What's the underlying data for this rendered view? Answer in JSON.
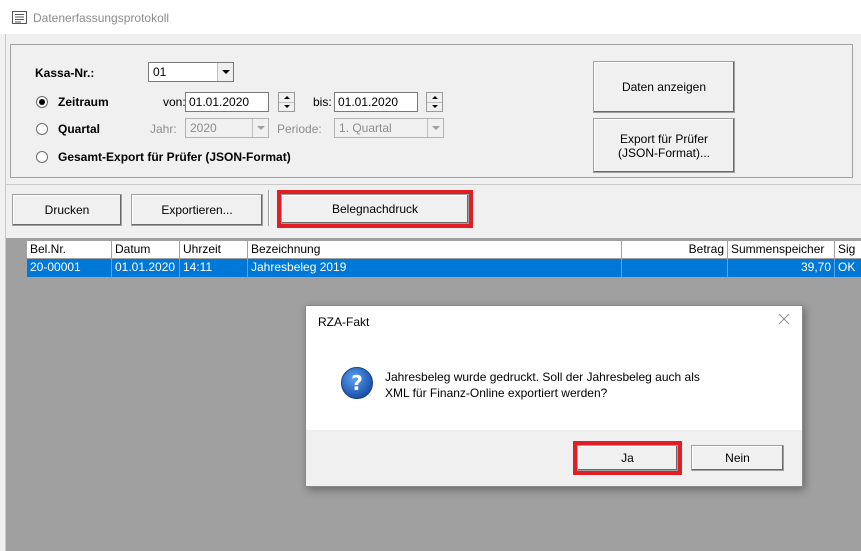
{
  "window": {
    "title": "Datenerfassungsprotokoll"
  },
  "filter": {
    "kassa_label": "Kassa-Nr.:",
    "kassa_value": "01",
    "zeitraum_label": "Zeitraum",
    "von_label": "von:",
    "von_value": "01.01.2020",
    "bis_label": "bis:",
    "bis_value": "01.01.2020",
    "quartal_label": "Quartal",
    "jahr_label": "Jahr:",
    "jahr_value": "2020",
    "periode_label": "Periode:",
    "periode_value": "1. Quartal",
    "gesamt_label": "Gesamt-Export für Prüfer (JSON-Format)",
    "selected": "zeitraum"
  },
  "side_buttons": {
    "daten_anzeigen": "Daten anzeigen",
    "export_line1": "Export für Prüfer",
    "export_line2": "(JSON-Format)..."
  },
  "toolbar": {
    "drucken": "Drucken",
    "exportieren": "Exportieren...",
    "belegnachdruck": "Belegnachdruck"
  },
  "table": {
    "columns": [
      "Bel.Nr.",
      "Datum",
      "Uhrzeit",
      "Bezeichnung",
      "Betrag",
      "Summenspeicher",
      "Sig"
    ],
    "rows": [
      [
        "20-00001",
        "01.01.2020",
        "14:11",
        "Jahresbeleg 2019",
        "",
        "39,70",
        "OK"
      ]
    ]
  },
  "dialog": {
    "title": "RZA-Fakt",
    "message_line1": "Jahresbeleg wurde gedruckt. Soll der Jahresbeleg auch als",
    "message_line2": "XML für Finanz-Online exportiert werden?",
    "yes": "Ja",
    "no": "Nein",
    "icon": "question-icon"
  },
  "colors": {
    "highlight": "#e11d26",
    "selection": "#0078d7",
    "table_background": "#a0a0a0"
  }
}
